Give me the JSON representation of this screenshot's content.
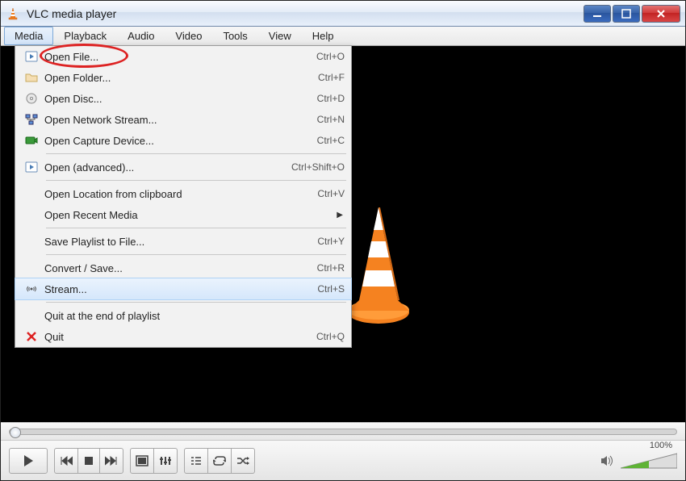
{
  "title": "VLC media player",
  "menubar": [
    "Media",
    "Playback",
    "Audio",
    "Video",
    "Tools",
    "View",
    "Help"
  ],
  "active_menu_index": 0,
  "dropdown": [
    {
      "icon": "play-file",
      "label": "Open File...",
      "shortcut": "Ctrl+O",
      "circled": true
    },
    {
      "icon": "folder",
      "label": "Open Folder...",
      "shortcut": "Ctrl+F"
    },
    {
      "icon": "disc",
      "label": "Open Disc...",
      "shortcut": "Ctrl+D"
    },
    {
      "icon": "network",
      "label": "Open Network Stream...",
      "shortcut": "Ctrl+N"
    },
    {
      "icon": "capture",
      "label": "Open Capture Device...",
      "shortcut": "Ctrl+C"
    },
    {
      "sep": true
    },
    {
      "icon": "play-file",
      "label": "Open (advanced)...",
      "shortcut": "Ctrl+Shift+O"
    },
    {
      "sep": true
    },
    {
      "icon": "",
      "label": "Open Location from clipboard",
      "shortcut": "Ctrl+V"
    },
    {
      "icon": "",
      "label": "Open Recent Media",
      "shortcut": "",
      "submenu": true
    },
    {
      "sep": true
    },
    {
      "icon": "",
      "label": "Save Playlist to File...",
      "shortcut": "Ctrl+Y"
    },
    {
      "sep": true
    },
    {
      "icon": "",
      "label": "Convert / Save...",
      "shortcut": "Ctrl+R"
    },
    {
      "icon": "stream",
      "label": "Stream...",
      "shortcut": "Ctrl+S",
      "hover": true
    },
    {
      "sep": true
    },
    {
      "icon": "",
      "label": "Quit at the end of playlist",
      "shortcut": ""
    },
    {
      "icon": "quit",
      "label": "Quit",
      "shortcut": "Ctrl+Q"
    }
  ],
  "volume_label": "100%"
}
